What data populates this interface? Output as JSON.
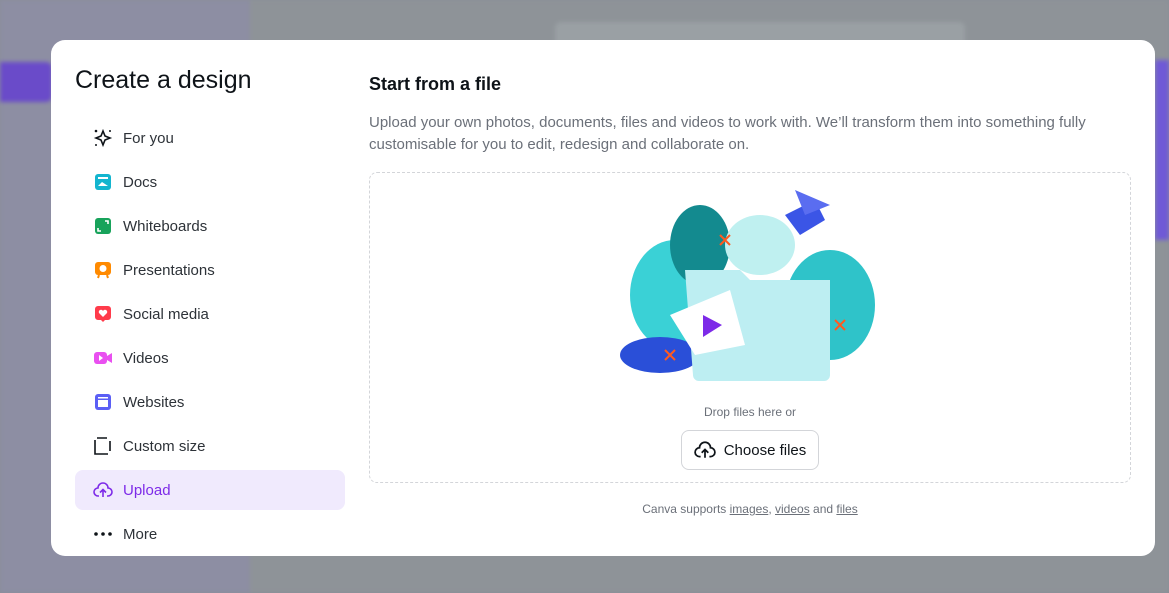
{
  "modal": {
    "title": "Create a design",
    "nav": [
      {
        "label": "For you",
        "icon": "sparkle-icon"
      },
      {
        "label": "Docs",
        "icon": "docs-icon"
      },
      {
        "label": "Whiteboards",
        "icon": "whiteboard-icon"
      },
      {
        "label": "Presentations",
        "icon": "presentation-icon"
      },
      {
        "label": "Social media",
        "icon": "heart-icon"
      },
      {
        "label": "Videos",
        "icon": "video-icon"
      },
      {
        "label": "Websites",
        "icon": "website-icon"
      },
      {
        "label": "Custom size",
        "icon": "custom-size-icon"
      },
      {
        "label": "Upload",
        "icon": "cloud-upload-icon",
        "active": true
      },
      {
        "label": "More",
        "icon": "more-icon"
      }
    ],
    "main": {
      "heading": "Start from a file",
      "description": "Upload your own photos, documents, files and videos to work with. We’ll transform them into something fully customisable for you to edit, redesign and collaborate on.",
      "drop_text": "Drop files here or",
      "choose_label": "Choose files",
      "support_prefix": "Canva supports ",
      "support_images": "images",
      "support_comma": ", ",
      "support_videos": "videos",
      "support_and": " and ",
      "support_files": "files"
    }
  },
  "colors": {
    "accent": "#7d2ae8",
    "active_bg": "#f0eafd"
  }
}
